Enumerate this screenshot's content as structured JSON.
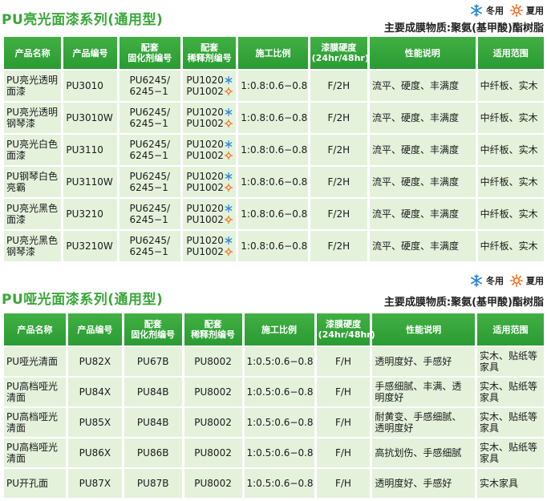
{
  "section1": {
    "title": "PU亮光面漆系列(通用型)",
    "legend": {
      "winter": "冬用",
      "summer": "夏用"
    },
    "subtitle": "主要成膜物质:聚氨(基甲酸)酯树脂",
    "headers": {
      "name": "产品名称",
      "code": "产品编号",
      "curing": [
        "配套",
        "固化剂编号"
      ],
      "thinner": [
        "配套",
        "稀释剂编号"
      ],
      "ratio": "施工比例",
      "hardness": [
        "漆膜硬度",
        "(24hr/48hr)"
      ],
      "performance": "性能说明",
      "scope": "适用范围"
    },
    "rows": [
      {
        "name": [
          "PU亮光透明",
          "面漆"
        ],
        "code": "PU3010",
        "curing": [
          "PU6245/",
          "6245−1"
        ],
        "thinner": [
          "PU1020",
          "PU1002"
        ],
        "ratio": "1:0.8:0.6−0.8",
        "hardness": "F/2H",
        "performance": "流平、硬度、丰满度",
        "scope": "中纤板、实木"
      },
      {
        "name": [
          "PU亮光透明",
          "钢琴漆"
        ],
        "code": "PU3010W",
        "curing": [
          "PU6245/",
          "6245−1"
        ],
        "thinner": [
          "PU1020",
          "PU1002"
        ],
        "ratio": "1:0.8:0.6−0.8",
        "hardness": "F/2H",
        "performance": "流平、硬度、丰满度",
        "scope": "中纤板、实木"
      },
      {
        "name": [
          "PU亮光白色",
          "面漆"
        ],
        "code": "PU3110",
        "curing": [
          "PU6245/",
          "6245−1"
        ],
        "thinner": [
          "PU1020",
          "PU1002"
        ],
        "ratio": "1:0.8:0.6−0.8",
        "hardness": "F/2H",
        "performance": "流平、硬度、丰满度",
        "scope": "中纤板、实木"
      },
      {
        "name": [
          "PU钢琴白色",
          "亮霸"
        ],
        "code": "PU3110W",
        "curing": [
          "PU6245/",
          "6245−1"
        ],
        "thinner": [
          "PU1020",
          "PU1002"
        ],
        "ratio": "1:0.8:0.6−0.8",
        "hardness": "F/2H",
        "performance": "流平、硬度、丰满度",
        "scope": "中纤板、实木"
      },
      {
        "name": [
          "PU亮光黑色",
          "面漆"
        ],
        "code": "PU3210",
        "curing": [
          "PU6245/",
          "6245−1"
        ],
        "thinner": [
          "PU1020",
          "PU1002"
        ],
        "ratio": "1:0.8:0.6−0.8",
        "hardness": "F/2H",
        "performance": "流平、硬度、丰满度",
        "scope": "中纤板、实木"
      },
      {
        "name": [
          "PU亮光黑色",
          "钢琴漆"
        ],
        "code": "PU3210W",
        "curing": [
          "PU6245/",
          "6245−1"
        ],
        "thinner": [
          "PU1020",
          "PU1002"
        ],
        "ratio": "1:0.8:0.6−0.8",
        "hardness": "F/2H",
        "performance": "流平、硬度、丰满度",
        "scope": "中纤板、实木"
      }
    ]
  },
  "section2": {
    "title": "PU哑光面漆系列(通用型)",
    "legend": {
      "winter": "冬用",
      "summer": "夏用"
    },
    "subtitle": "主要成膜物质:聚氨(基甲酸)酯树脂",
    "headers": {
      "name": "产品名称",
      "code": "产品编号",
      "curing": [
        "配套",
        "固化剂编号"
      ],
      "thinner": [
        "配套",
        "稀释剂编号"
      ],
      "ratio": "施工比例",
      "hardness": [
        "漆膜硬度",
        "(24hr/48hr)"
      ],
      "performance": "性能说明",
      "scope": "适用范围"
    },
    "rows": [
      {
        "name": [
          "PU哑光清面"
        ],
        "code": "PU82X",
        "curing": "PU67B",
        "thinner": "PU8002",
        "ratio": "1:0.5:0.6−0.8",
        "hardness": "F/H",
        "performance": [
          "透明度好、手感好"
        ],
        "scope": [
          "实木、贴纸等",
          "家具"
        ]
      },
      {
        "name": [
          "PU高档哑光",
          "清面"
        ],
        "code": "PU84X",
        "curing": "PU84B",
        "thinner": "PU8002",
        "ratio": "1:0.5:0.6−0.8",
        "hardness": "F/H",
        "performance": [
          "手感细腻、丰满、透",
          "明度好"
        ],
        "scope": [
          "实木、贴纸等",
          "家具"
        ]
      },
      {
        "name": [
          "PU高档哑光",
          "清面"
        ],
        "code": "PU85X",
        "curing": "PU84B",
        "thinner": "PU8002",
        "ratio": "1:0.5:0.6−0.8",
        "hardness": "F/H",
        "performance": [
          "耐黄变、手感细腻、",
          "透明度好"
        ],
        "scope": [
          "实木、贴纸等",
          "家具"
        ]
      },
      {
        "name": [
          "PU高档哑光",
          "清面"
        ],
        "code": "PU86X",
        "curing": "PU86B",
        "thinner": "PU8002",
        "ratio": "1:0.5:0.6−0.8",
        "hardness": "F/H",
        "performance": [
          "高抗划伤、手感细腻"
        ],
        "scope": [
          "实木、贴纸等",
          "家具"
        ]
      },
      {
        "name": [
          "PU开孔面"
        ],
        "code": "PU87X",
        "curing": "PU87B",
        "thinner": "PU8002",
        "ratio": "1:0.5:0.6−0.8",
        "hardness": "F/H",
        "performance": [
          "透明度好、手感好"
        ],
        "scope": [
          "实木家具"
        ]
      }
    ]
  },
  "icons": {
    "winter": "snowflake-icon",
    "summer": "sun-icon",
    "winter_color": "#2a86d6",
    "summer_color": "#ef6a1a"
  },
  "colors": {
    "title": "#3aa73a",
    "header_bg": "#2fa23a",
    "cell_bg": "#e4f2dc"
  }
}
